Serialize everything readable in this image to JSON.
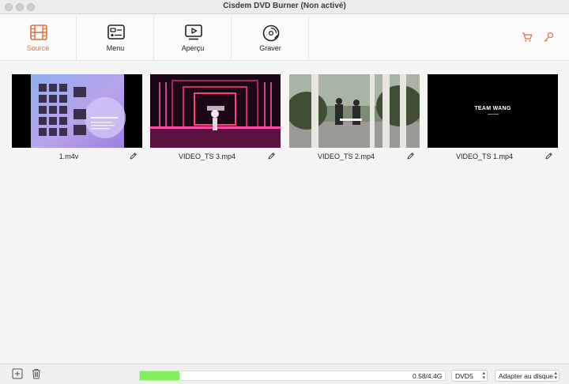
{
  "window": {
    "title": "Cisdem DVD Burner (Non activé)"
  },
  "toolbar": {
    "tabs": [
      {
        "label": "Source",
        "icon": "film-icon",
        "active": true
      },
      {
        "label": "Menu",
        "icon": "menu-layout-icon",
        "active": false
      },
      {
        "label": "Aperçu",
        "icon": "play-screen-icon",
        "active": false
      },
      {
        "label": "Graver",
        "icon": "disc-icon",
        "active": false
      }
    ],
    "right_icons": [
      "cart-icon",
      "key-icon"
    ],
    "accent": "#e0703f"
  },
  "videos": [
    {
      "name": "1.m4v"
    },
    {
      "name": "VIDEO_TS 3.mp4"
    },
    {
      "name": "VIDEO_TS 2.mp4"
    },
    {
      "name": "VIDEO_TS 1.mp4",
      "overlay_title": "TEAM WANG"
    }
  ],
  "status": {
    "add_icon": "add-icon",
    "delete_icon": "trash-icon",
    "size_text": "0.58/4.4G",
    "progress_fraction": 0.13,
    "progress_color": "#7ef058",
    "disc_type": "DVD5",
    "fit_mode": "Adapter au disque"
  }
}
